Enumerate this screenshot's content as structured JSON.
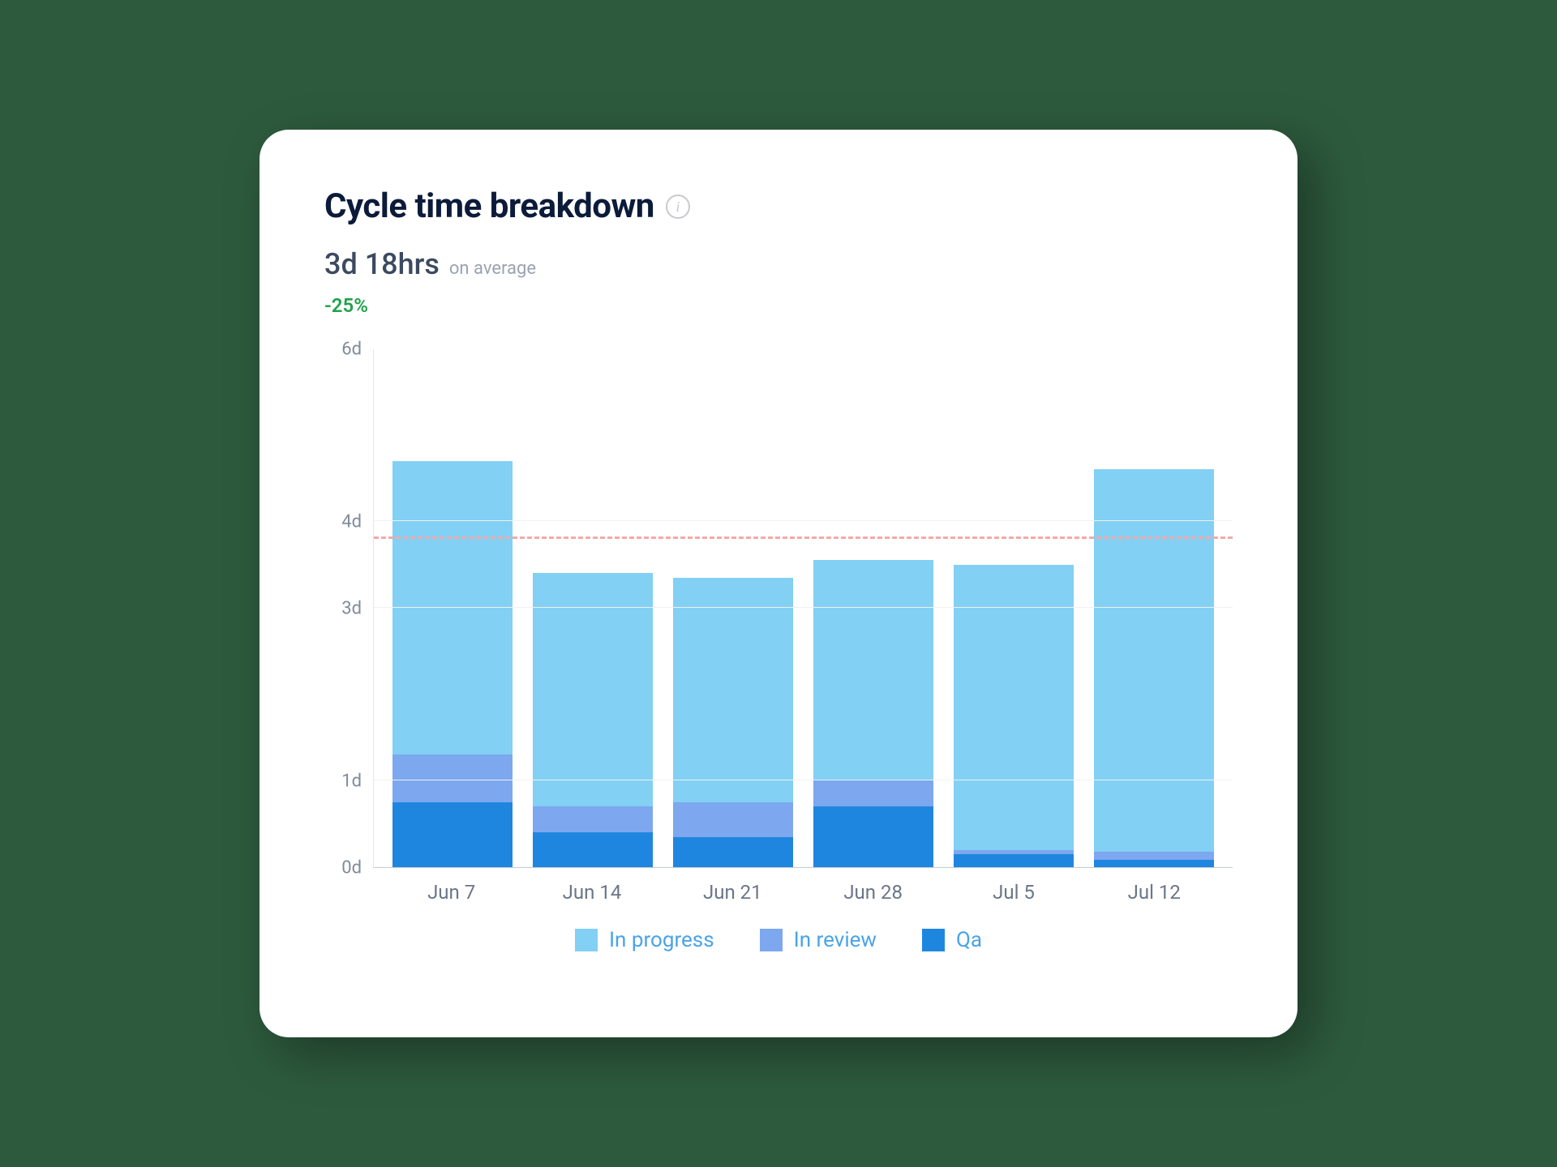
{
  "title": "Cycle time breakdown",
  "metric": "3d 18hrs",
  "metric_suffix": "on average",
  "delta": "-25%",
  "legend": {
    "in_progress": "In progress",
    "in_review": "In review",
    "qa": "Qa"
  },
  "y_ticks": [
    "0d",
    "1d",
    "3d",
    "4d",
    "6d"
  ],
  "x_ticks": [
    "Jun 7",
    "Jun 14",
    "Jun 21",
    "Jun 28",
    "Jul 5",
    "Jul 12"
  ],
  "colors": {
    "in_progress": "#82d0f3",
    "in_review": "#7da7ef",
    "qa": "#1f86e0",
    "reference": "#f6a8a8",
    "delta": "#1fa24a"
  },
  "chart_data": {
    "type": "bar",
    "stacked": true,
    "title": "Cycle time breakdown",
    "ylabel": "days",
    "xlabel": "",
    "ylim": [
      0,
      6
    ],
    "reference_line": 3.8,
    "categories": [
      "Jun 7",
      "Jun 14",
      "Jun 21",
      "Jun 28",
      "Jul 5",
      "Jul 12"
    ],
    "series": [
      {
        "name": "Qa",
        "color": "#1f86e0",
        "values": [
          0.75,
          0.4,
          0.35,
          0.7,
          0.15,
          0.08
        ]
      },
      {
        "name": "In review",
        "color": "#7da7ef",
        "values": [
          0.55,
          0.3,
          0.4,
          0.3,
          0.05,
          0.1
        ]
      },
      {
        "name": "In progress",
        "color": "#82d0f3",
        "values": [
          3.4,
          2.7,
          2.6,
          2.55,
          3.3,
          4.42
        ]
      }
    ]
  }
}
